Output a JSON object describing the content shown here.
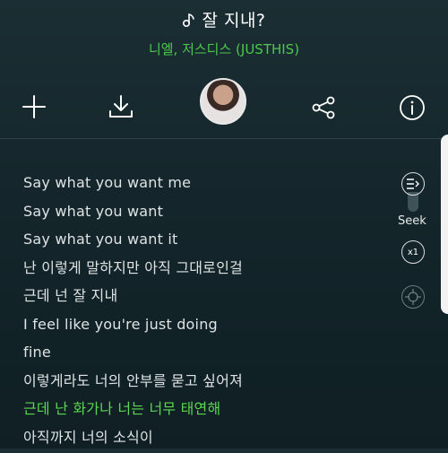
{
  "header": {
    "title": "잘 지내?",
    "artist": "니엘, 저스디스 (JUSTHIS)"
  },
  "toolbar": {
    "icons": [
      "plus-icon",
      "download-icon",
      "share-icon",
      "info-icon"
    ]
  },
  "lyrics": {
    "lines": [
      "Say what you want me",
      "Say what you want",
      "Say what you want it",
      "난 이렇게 말하지만 아직 그대로인걸",
      "근데 넌 잘 지내",
      "I feel like you're just doing",
      "fine",
      "이렇게라도 너의 안부를 묻고 싶어져",
      "근데 난 화가나 너는 너무 태연해",
      "아직까지 너의 소식이"
    ],
    "current_index": 8
  },
  "side_controls": {
    "seek_label": "Seek",
    "speed_label": "x1"
  },
  "colors": {
    "accent": "#5ad84f",
    "background": "#14262b"
  }
}
